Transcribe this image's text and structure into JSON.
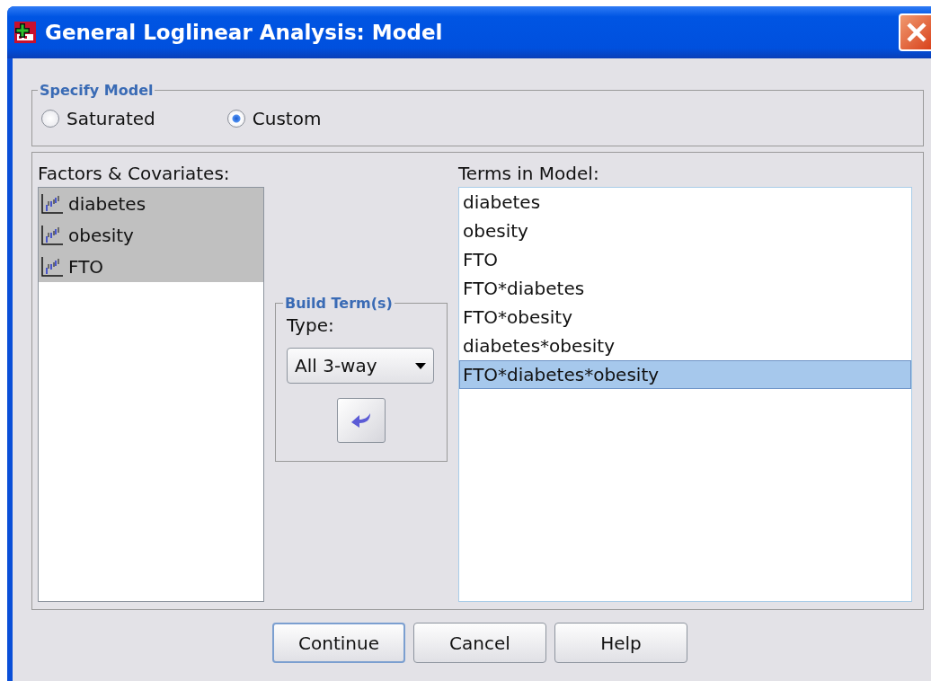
{
  "window": {
    "title": "General Loglinear Analysis: Model"
  },
  "specify_model": {
    "title": "Specify Model",
    "options": [
      {
        "label": "Saturated",
        "selected": false
      },
      {
        "label": "Custom",
        "selected": true
      }
    ]
  },
  "factors": {
    "label": "Factors & Covariates:",
    "items": [
      {
        "name": "diabetes",
        "selected": true
      },
      {
        "name": "obesity",
        "selected": true
      },
      {
        "name": "FTO",
        "selected": true
      }
    ]
  },
  "build_terms": {
    "title": "Build Term(s)",
    "type_label": "Type:",
    "type_value": "All 3-way"
  },
  "terms": {
    "label": "Terms in Model:",
    "items": [
      {
        "name": "diabetes",
        "selected": false
      },
      {
        "name": "obesity",
        "selected": false
      },
      {
        "name": "FTO",
        "selected": false
      },
      {
        "name": "FTO*diabetes",
        "selected": false
      },
      {
        "name": "FTO*obesity",
        "selected": false
      },
      {
        "name": "diabetes*obesity",
        "selected": false
      },
      {
        "name": "FTO*diabetes*obesity",
        "selected": true
      }
    ]
  },
  "buttons": [
    {
      "label": "Continue",
      "default": true
    },
    {
      "label": "Cancel",
      "default": false
    },
    {
      "label": "Help",
      "default": false
    }
  ]
}
